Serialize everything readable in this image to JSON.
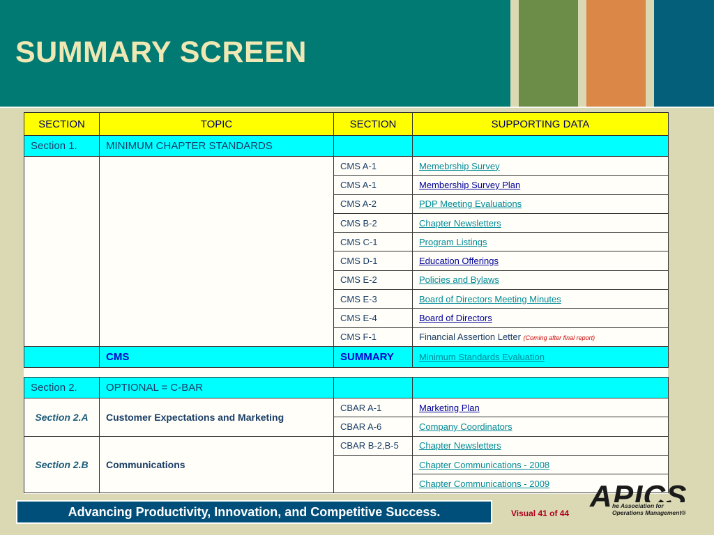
{
  "title": "SUMMARY SCREEN",
  "colors": {
    "header_teal": "#007a72",
    "bar_green": "#6c8d47",
    "bar_orange": "#db8747",
    "bar_blue": "#04607a",
    "header_yellow": "#ffff00",
    "section_cyan": "#00ffff",
    "footer_blue": "#004f7a"
  },
  "table_headers": {
    "section": "SECTION",
    "topic": "TOPIC",
    "section2": "SECTION",
    "supporting": "SUPPORTING DATA"
  },
  "section1": {
    "label": "Section 1.",
    "topic": "MINIMUM CHAPTER STANDARDS",
    "rows": [
      {
        "code": "CMS A-1",
        "link": "Memebrship Survey"
      },
      {
        "code": "CMS A-1",
        "link": "Membership Survey Plan"
      },
      {
        "code": "CMS A-2",
        "link": "PDP Meeting Evaluations"
      },
      {
        "code": "CMS B-2",
        "link": "Chapter Newsletters"
      },
      {
        "code": "CMS C-1",
        "link": "Program Listings"
      },
      {
        "code": "CMS D-1",
        "link": "Education Offerings"
      },
      {
        "code": "CMS E-2",
        "link": "Policies and Bylaws"
      },
      {
        "code": "CMS E-3",
        "link": "Board of Directors Meeting Minutes"
      },
      {
        "code": "CMS E-4",
        "link": "Board of Directors"
      },
      {
        "code": "CMS F-1",
        "link": "Financial Assertion Letter",
        "note": "(Coming after final report)"
      }
    ],
    "summary": {
      "topic": "CMS",
      "section": "SUMMARY",
      "link": "Minimum Standards Evaluation"
    }
  },
  "section2": {
    "label": "Section 2.",
    "topic": "OPTIONAL = C-BAR",
    "a": {
      "label": "Section 2.A",
      "topic": "Customer Expectations and Marketing",
      "rows": [
        {
          "code": "CBAR A-1",
          "link": "Marketing Plan"
        },
        {
          "code": "CBAR A-6",
          "link": "Company Coordinators"
        }
      ]
    },
    "b": {
      "label": "Section 2.B",
      "topic": "Communications",
      "rows": [
        {
          "code": "CBAR B-2,B-5",
          "link": "Chapter Newsletters"
        },
        {
          "code": "",
          "link": "Chapter Communications - 2008"
        },
        {
          "code": "",
          "link": "Chapter Communications - 2009"
        }
      ]
    }
  },
  "footer": {
    "tagline": "Advancing Productivity, Innovation, and Competitive Success.",
    "visual": "Visual 41 of 44"
  },
  "logo": {
    "word": "APICS",
    "sub_line1": "he Association for",
    "sub_line2": "Operations Management"
  }
}
